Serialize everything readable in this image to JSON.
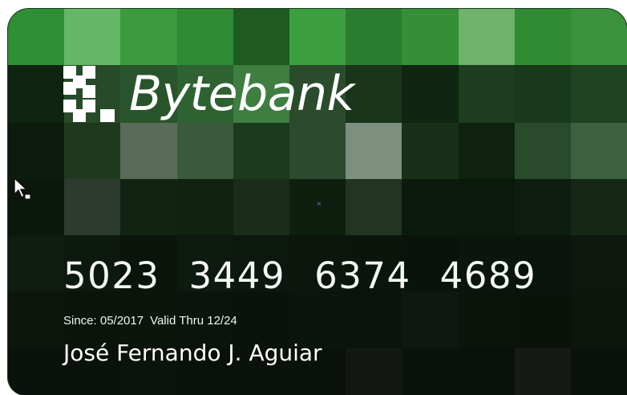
{
  "card": {
    "brand_name": "Bytebank",
    "number_groups": [
      "5023",
      "3449",
      "6374",
      "4689"
    ],
    "since": "Since: 05/2017",
    "valid_thru": "Valid Thru 12/24",
    "holder_name": "José Fernando J. Aguiar"
  },
  "icons": {
    "logo": "bytebank-pixel-logo-icon",
    "cursor": "mouse-pointer-icon",
    "center_marker": "crosshair-marker-icon"
  },
  "colors": {
    "card_dark": "#0a120b",
    "accent_green": "#3c9a3e",
    "text": "#ffffff"
  }
}
